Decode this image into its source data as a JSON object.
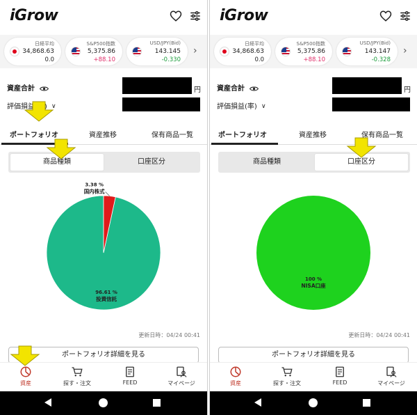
{
  "app": {
    "logo": "iGrow"
  },
  "colors": {
    "accent_red": "#c0392b",
    "arrow_yellow": "#f2e400",
    "pie_teal": "#1db98a",
    "pie_red": "#e01b1b",
    "pie_green": "#1ed21e"
  },
  "icons": [
    "heart-icon",
    "filter-icon",
    "eye-icon",
    "chevron-down-icon",
    "chevron-right-icon",
    "pie-chart-icon",
    "cart-icon",
    "feed-icon",
    "mypage-icon"
  ],
  "panels": [
    {
      "tickers": [
        {
          "name": "日経平均",
          "value": "34,868.63",
          "change": "0.0",
          "dir": "zero",
          "flag": "jp"
        },
        {
          "name": "S&P500指数",
          "value": "5,375.86",
          "change": "+88.10",
          "dir": "up",
          "flag": "us"
        },
        {
          "name": "USD/JPY(Bid)",
          "value": "143.145",
          "change": "-0.330",
          "dir": "down",
          "flag": "us"
        }
      ],
      "assets_label": "資産合計",
      "yen": "円",
      "pnl_label": "評価損益(率)",
      "tabs": [
        "ポートフォリオ",
        "資産推移",
        "保有商品一覧"
      ],
      "active_tab": 0,
      "segments": [
        "商品種類",
        "口座区分"
      ],
      "active_segment": 0,
      "updated": "更新日時：04/24 00:41",
      "detail_button": "ポートフォリオ詳細を見る",
      "nav": [
        "資産",
        "探す・注文",
        "FEED",
        "マイページ"
      ]
    },
    {
      "tickers": [
        {
          "name": "日経平均",
          "value": "34,868.63",
          "change": "0.0",
          "dir": "zero",
          "flag": "jp"
        },
        {
          "name": "S&P500指数",
          "value": "5,375.86",
          "change": "+88.10",
          "dir": "up",
          "flag": "us"
        },
        {
          "name": "USD/JPY(Bid)",
          "value": "143.147",
          "change": "-0.328",
          "dir": "down",
          "flag": "us"
        }
      ],
      "assets_label": "資産合計",
      "yen": "円",
      "pnl_label": "評価損益(率)",
      "tabs": [
        "ポートフォリオ",
        "資産推移",
        "保有商品一覧"
      ],
      "active_tab": 0,
      "segments": [
        "商品種類",
        "口座区分"
      ],
      "active_segment": 1,
      "updated": "更新日時：04/24 00:41",
      "detail_button": "ポートフォリオ詳細を見る",
      "nav": [
        "資産",
        "探す・注文",
        "FEED",
        "マイページ"
      ]
    }
  ],
  "chart_data": [
    {
      "type": "pie",
      "slices": [
        {
          "label": "投資信託",
          "percent_label": "96.61 %",
          "value": 96.61,
          "color": "#1db98a"
        },
        {
          "label": "国内株式",
          "percent_label": "3.38 %",
          "value": 3.38,
          "color": "#e01b1b"
        }
      ]
    },
    {
      "type": "pie",
      "slices": [
        {
          "label": "NISA口座",
          "percent_label": "100 %",
          "value": 100,
          "color": "#1ed21e"
        }
      ]
    }
  ]
}
